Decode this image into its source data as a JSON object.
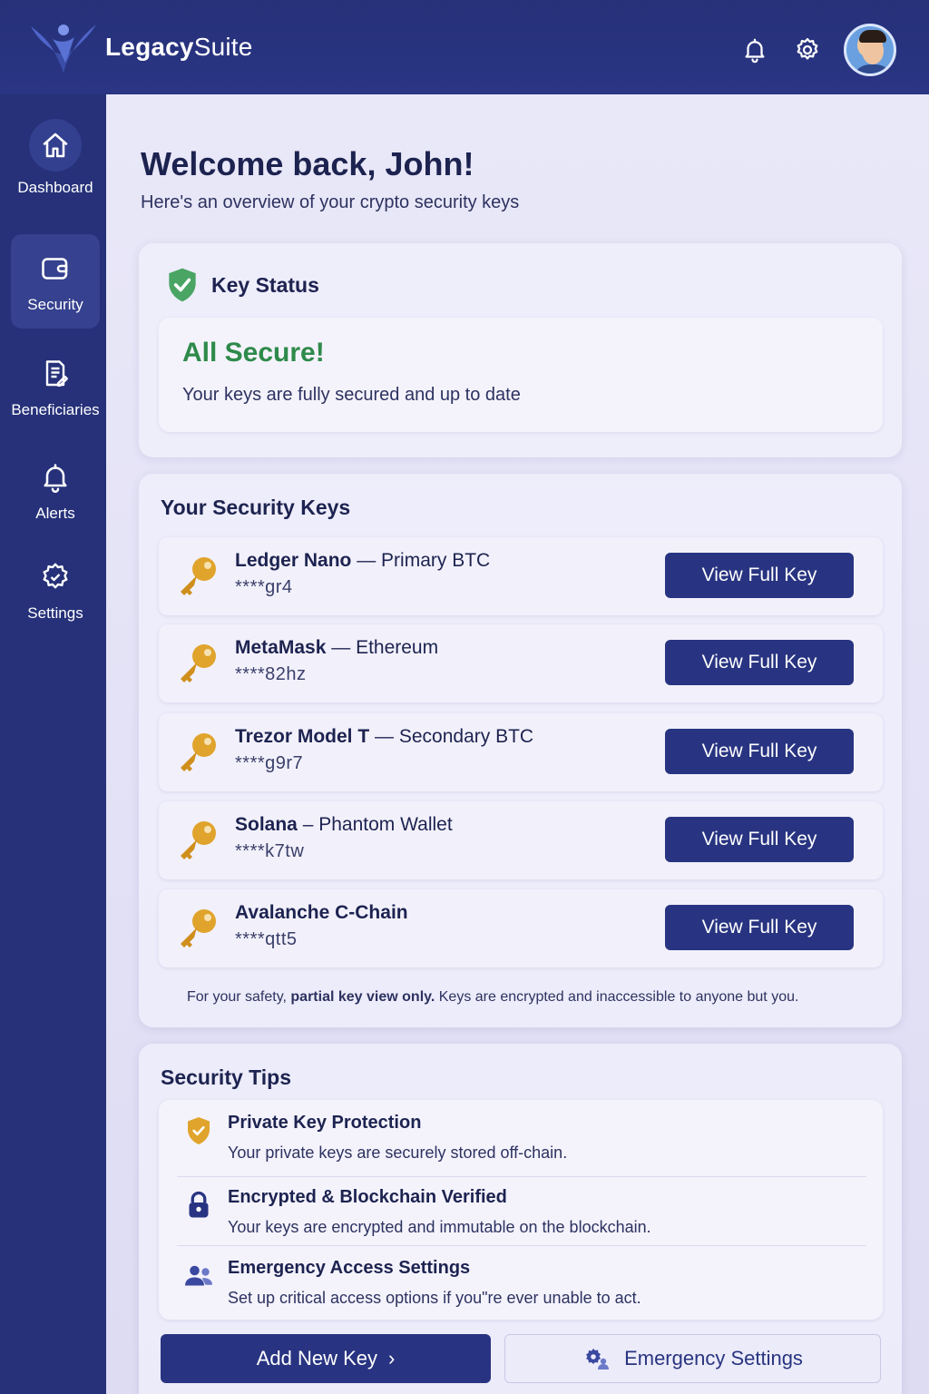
{
  "brand": {
    "name_bold": "Legacy",
    "name_light": "Suite"
  },
  "header": {
    "icons": [
      "bell-icon",
      "gear-icon"
    ],
    "avatar": "user-avatar"
  },
  "sidebar": {
    "items": [
      {
        "label": "Dashboard",
        "icon": "home-icon"
      },
      {
        "label": "Security",
        "icon": "wallet-icon",
        "active": true
      },
      {
        "label": "Beneficiaries",
        "icon": "document-icon"
      },
      {
        "label": "Alerts",
        "icon": "bell-icon"
      },
      {
        "label": "Settings",
        "icon": "gear-icon"
      }
    ]
  },
  "main": {
    "title": "Welcome back, John!",
    "subtitle": "Here's an overview of your crypto security keys"
  },
  "status": {
    "heading": "Key Status",
    "title": "All Secure!",
    "text": "Your keys are fully secured and up to date",
    "color": "#2e8a4a"
  },
  "keys": {
    "heading": "Your Security Keys",
    "button_label": "View Full Key",
    "items": [
      {
        "name": "Ledger Nano",
        "sep": " — ",
        "desc": "Primary BTC",
        "mask": "****gr4"
      },
      {
        "name": "MetaMask",
        "sep": " — ",
        "desc": "Ethereum",
        "mask": "****82hz"
      },
      {
        "name": "Trezor Model T",
        "sep": " — ",
        "desc": "Secondary BTC",
        "mask": "****g9r7"
      },
      {
        "name": "Solana",
        "sep": " – ",
        "desc": "Phantom Wallet",
        "mask": "****k7tw"
      },
      {
        "name": "Avalanche C-Chain",
        "sep": "",
        "desc": "",
        "mask": "****qtt5"
      }
    ],
    "note_before": "For your safety, ",
    "note_bold": "partial key view only.",
    "note_after": " Keys are encrypted and inaccessible to anyone but you."
  },
  "tips": {
    "heading": "Security Tips",
    "items": [
      {
        "title": "Private Key Protection",
        "text": "Your private keys are securely stored off-chain.",
        "icon": "shield-icon"
      },
      {
        "title": "Encrypted & Blockchain Verified",
        "text": "Your keys are encrypted and immutable on the blockchain.",
        "icon": "lock-icon"
      },
      {
        "title": "Emergency Access Settings",
        "text": "Set up critical access options if you\"re ever unable to act.",
        "icon": "users-icon"
      }
    ]
  },
  "actions": {
    "add_key": "Add New Key",
    "emergency": "Emergency Settings"
  },
  "colors": {
    "primary": "#283481",
    "sidebar": "#263179",
    "accent_gold": "#e0a42c"
  }
}
